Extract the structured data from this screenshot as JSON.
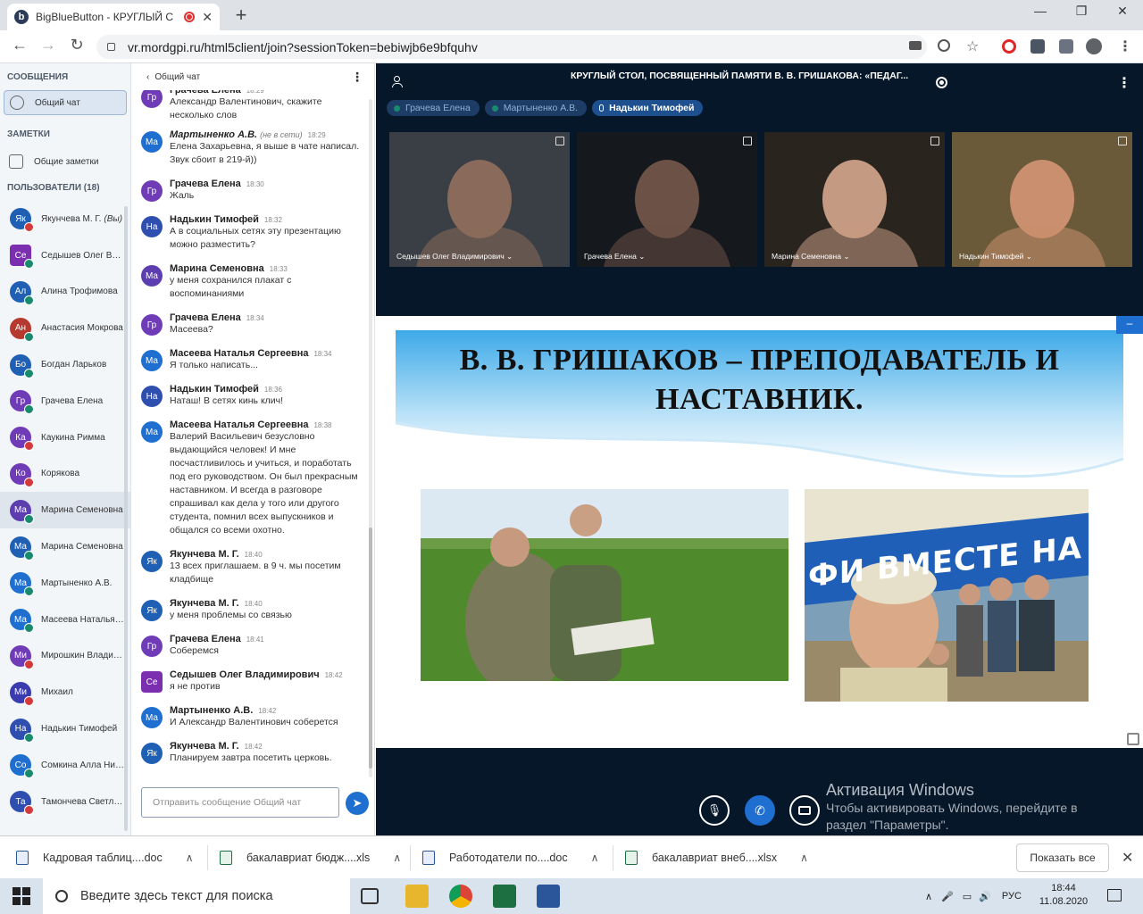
{
  "browser": {
    "tab_title": "BigBlueButton - КРУГЛЫЙ С",
    "url": "vr.mordgpi.ru/html5client/join?sessionToken=bebiwjb6e9bfquhv"
  },
  "sidebar": {
    "messages_title": "СООБЩЕНИЯ",
    "public_chat": "Общий чат",
    "notes_title": "ЗАМЕТКИ",
    "shared_notes": "Общие заметки",
    "users_title": "ПОЛЬЗОВАТЕЛИ (18)",
    "users": [
      {
        "initials": "Як",
        "name": "Якунчева М. Г.",
        "suffix": "(Вы)",
        "mic": "muted",
        "color": "#1f5fb4"
      },
      {
        "initials": "Се",
        "name": "Седышев Олег Владимирович",
        "mic": "on",
        "color": "#7b2fb0",
        "presenter": true
      },
      {
        "initials": "Ал",
        "name": "Алина Трофимова",
        "mic": "on",
        "color": "#1f5fb4"
      },
      {
        "initials": "Ан",
        "name": "Анастасия Мокрова",
        "mic": "on",
        "color": "#b5392f"
      },
      {
        "initials": "Бо",
        "name": "Богдан Ларьков",
        "mic": "on",
        "color": "#1f5fb4"
      },
      {
        "initials": "Гр",
        "name": "Грачева Елена",
        "mic": "on",
        "color": "#6f3bb6"
      },
      {
        "initials": "Ка",
        "name": "Каукина Римма",
        "mic": "muted",
        "color": "#6f3bb6"
      },
      {
        "initials": "Ко",
        "name": "Корякова",
        "mic": "muted",
        "color": "#6f3bb6"
      },
      {
        "initials": "Ма",
        "name": "Марина Семеновна",
        "mic": "on",
        "color": "#5c3eb0",
        "selected": true
      },
      {
        "initials": "Ма",
        "name": "Марина Семеновна",
        "mic": "on",
        "color": "#1f5fb4"
      },
      {
        "initials": "Ма",
        "name": "Мартыненко А.В.",
        "mic": "on",
        "color": "#1f6fd1"
      },
      {
        "initials": "Ма",
        "name": "Масеева Наталья Сергеевна",
        "mic": "on",
        "color": "#1f6fd1"
      },
      {
        "initials": "Ми",
        "name": "Мирошкин Владимир",
        "mic": "muted",
        "color": "#6f3bb6"
      },
      {
        "initials": "Ми",
        "name": "Михаил",
        "mic": "muted",
        "color": "#3b3bb0"
      },
      {
        "initials": "На",
        "name": "Надькин Тимофей",
        "mic": "on",
        "color": "#2f4fb0"
      },
      {
        "initials": "Со",
        "name": "Сомкина Алла Николаевна",
        "mic": "on",
        "color": "#1f6fd1"
      },
      {
        "initials": "Та",
        "name": "Тамончева Светлана",
        "mic": "muted",
        "color": "#2f4fb0"
      }
    ]
  },
  "chat": {
    "header": "Общий чат",
    "messages": [
      {
        "initials": "Гр",
        "name": "Грачева Елена",
        "time": "18:29",
        "text": "Александр Валентинович, скажите несколько слов",
        "color": "#6f3bb6",
        "partial": true
      },
      {
        "initials": "Ма",
        "name": "Мартыненко А.В.",
        "status": "(не в сети)",
        "time": "18:29",
        "text": "Елена Захарьевна, я выше в чате написал. Звук сбоит в 219-й))",
        "color": "#1f6fd1",
        "italic": true
      },
      {
        "initials": "Гр",
        "name": "Грачева Елена",
        "time": "18:30",
        "text": "Жаль",
        "color": "#6f3bb6"
      },
      {
        "initials": "На",
        "name": "Надькин Тимофей",
        "time": "18:32",
        "text": "А в социальных сетях эту презентацию можно разместить?",
        "color": "#2f4fb0"
      },
      {
        "initials": "Ма",
        "name": "Марина Семеновна",
        "time": "18:33",
        "text": "у меня сохранился плакат с воспоминаниями",
        "color": "#5c3eb0"
      },
      {
        "initials": "Гр",
        "name": "Грачева Елена",
        "time": "18:34",
        "text": "Масеева?",
        "color": "#6f3bb6"
      },
      {
        "initials": "Ма",
        "name": "Масеева Наталья Сергеевна",
        "time": "18:34",
        "text": "Я только написать...",
        "color": "#1f6fd1"
      },
      {
        "initials": "На",
        "name": "Надькин Тимофей",
        "time": "18:36",
        "text": "Наташ! В сетях кинь клич!",
        "color": "#2f4fb0"
      },
      {
        "initials": "Ма",
        "name": "Масеева Наталья Сергеевна",
        "time": "18:38",
        "text": "Валерий Васильевич безусловно выдающийся человек! И мне посчастливилось и учиться, и поработать под его руководством. Он был прекрасным наставником. И всегда в разговоре спрашивал как дела у того или другого студента, помнил всех выпускников и общался со всеми охотно.",
        "color": "#1f6fd1"
      },
      {
        "initials": "Як",
        "name": "Якунчева М. Г.",
        "time": "18:40",
        "text": "13 всех приглашаем. в 9 ч. мы посетим кладбище",
        "color": "#1f5fb4"
      },
      {
        "initials": "Як",
        "name": "Якунчева М. Г.",
        "time": "18:40",
        "text": "у меня проблемы со связью",
        "color": "#1f5fb4"
      },
      {
        "initials": "Гр",
        "name": "Грачева Елена",
        "time": "18:41",
        "text": "Соберемся",
        "color": "#6f3bb6"
      },
      {
        "initials": "Се",
        "name": "Седышев Олег Владимирович",
        "time": "18:42",
        "text": "я не против",
        "color": "#7b2fb0",
        "presenter": true
      },
      {
        "initials": "Ма",
        "name": "Мартыненко А.В.",
        "time": "18:42",
        "text": "И Александр Валентинович соберется",
        "color": "#1f6fd1"
      },
      {
        "initials": "Як",
        "name": "Якунчева М. Г.",
        "time": "18:42",
        "text": "Планируем завтра посетить церковь.",
        "color": "#1f5fb4"
      }
    ],
    "input_placeholder": "Отправить сообщение Общий чат"
  },
  "main": {
    "title": "КРУГЛЫЙ СТОЛ, ПОСВЯЩЕННЫЙ ПАМЯТИ В. В. ГРИШАКОВА: «ПЕДАГ...",
    "talkers": [
      {
        "name": "Грачева Елена",
        "active": false
      },
      {
        "name": "Мартыненко А.В.",
        "active": false
      },
      {
        "name": "Надькин Тимофей",
        "active": true
      }
    ],
    "videos": [
      {
        "name": "Седышев Олег Владимирович",
        "bg": "#3a3f46",
        "face": "#8a6a5a"
      },
      {
        "name": "Грачева Елена",
        "bg": "#15181c",
        "face": "#6b5146"
      },
      {
        "name": "Марина Семеновна",
        "bg": "#2a241f",
        "face": "#c59a82"
      },
      {
        "name": "Надькин Тимофей",
        "bg": "#6b5a3a",
        "face": "#c98f6e"
      }
    ],
    "slide_title_line1": "В. В. ГРИШАКОВ – ПРЕПОДАВАТЕЛЬ И",
    "slide_title_line2": "НАСТАВНИК.",
    "banner_text": "ФИ   ВМЕСТЕ НА",
    "win_activation_title": "Активация Windows",
    "win_activation_text1": "Чтобы активировать Windows, перейдите в",
    "win_activation_text2": "раздел \"Параметры\"."
  },
  "downloads": [
    {
      "name": "Кадровая таблиц....doc",
      "type": "word"
    },
    {
      "name": "бакалавриат бюдж....xls",
      "type": "excel"
    },
    {
      "name": "Работодатели по....doc",
      "type": "word"
    },
    {
      "name": "бакалавриат внеб....xlsx",
      "type": "excel"
    }
  ],
  "downloads_show_all": "Показать все",
  "taskbar": {
    "search_placeholder": "Введите здесь текст для поиска",
    "lang": "РУС",
    "time": "18:44",
    "date": "11.08.2020"
  }
}
